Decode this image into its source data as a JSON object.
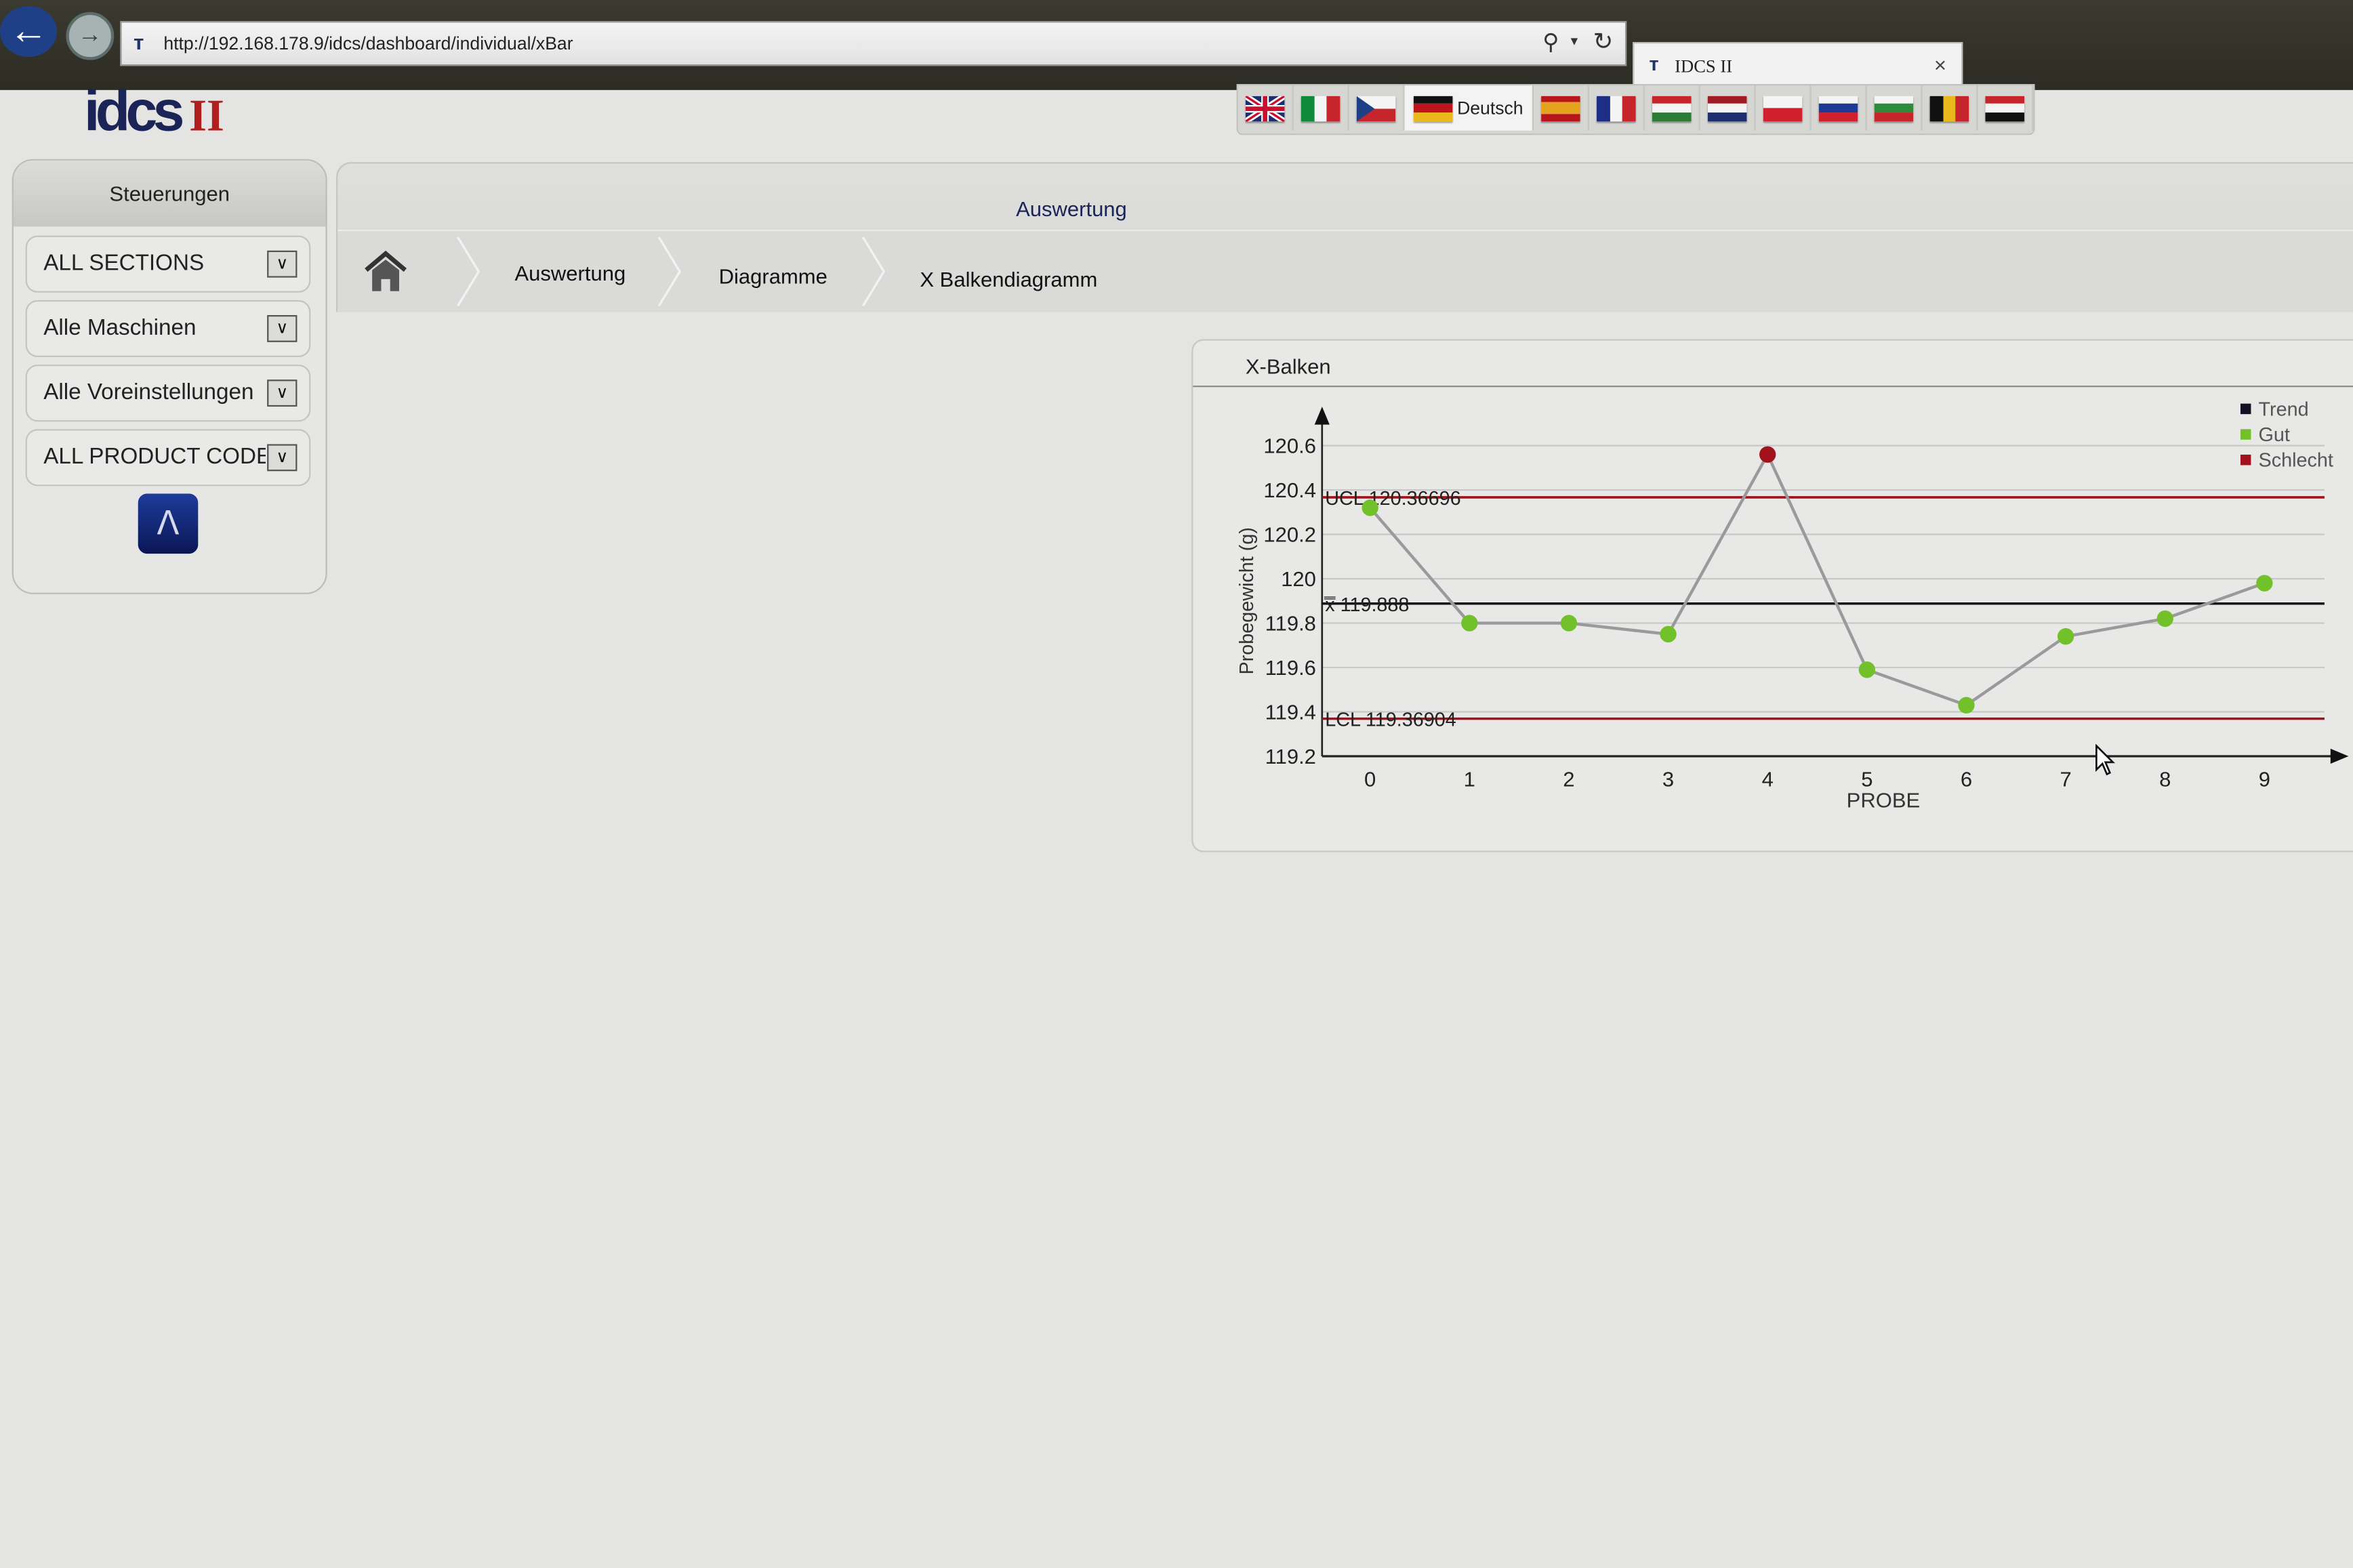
{
  "browser": {
    "url": "http://192.168.178.9/idcs/dashboard/individual/xBar",
    "tab_title": "IDCS II",
    "tab_close": "×",
    "back_icon": "arrow-left-icon",
    "forward_icon": "arrow-right-icon"
  },
  "header": {
    "logo_text": "idcs",
    "logo_roman": "II",
    "languages": [
      {
        "code": "en",
        "label": "",
        "colors": [
          "#1f2f6e",
          "#c8102e",
          "#ffffff"
        ],
        "dir": "uk"
      },
      {
        "code": "it",
        "label": "",
        "colors": [
          "#0f8a3a",
          "#f4f4f4",
          "#c6252c"
        ],
        "dir": "v"
      },
      {
        "code": "cz",
        "label": "",
        "colors": [
          "#f4f4f4",
          "#c6252c",
          "#1d3f86"
        ],
        "dir": "cz"
      },
      {
        "code": "de",
        "label": "Deutsch",
        "colors": [
          "#111111",
          "#c0141c",
          "#e9b81a"
        ],
        "dir": "h",
        "active": true
      },
      {
        "code": "es",
        "label": "",
        "colors": [
          "#b6151c",
          "#e5a21e",
          "#b6151c"
        ],
        "dir": "es"
      },
      {
        "code": "fr",
        "label": "",
        "colors": [
          "#1d2e85",
          "#f4f4f4",
          "#c6252c"
        ],
        "dir": "v"
      },
      {
        "code": "hu",
        "label": "",
        "colors": [
          "#c6252c",
          "#f4f4f4",
          "#2d7c35"
        ],
        "dir": "h"
      },
      {
        "code": "nl",
        "label": "",
        "colors": [
          "#a11b24",
          "#f4f4f4",
          "#1d2e6e"
        ],
        "dir": "h"
      },
      {
        "code": "pl",
        "label": "",
        "colors": [
          "#f4f4f4",
          "#d0202e"
        ],
        "dir": "h"
      },
      {
        "code": "ru",
        "label": "",
        "colors": [
          "#f4f4f4",
          "#1d3a95",
          "#d0202e"
        ],
        "dir": "h"
      },
      {
        "code": "bg",
        "label": "",
        "colors": [
          "#f4f4f4",
          "#2f8a3a",
          "#c6252c"
        ],
        "dir": "h"
      },
      {
        "code": "be",
        "label": "",
        "colors": [
          "#111111",
          "#e9b81a",
          "#c6252c"
        ],
        "dir": "v"
      },
      {
        "code": "eg",
        "label": "",
        "colors": [
          "#c6252c",
          "#f4f4f4",
          "#111111"
        ],
        "dir": "h"
      }
    ]
  },
  "sidebar": {
    "title": "Steuerungen",
    "selects": [
      {
        "value": "ALL SECTIONS"
      },
      {
        "value": "Alle Maschinen"
      },
      {
        "value": "Alle Voreinstellungen"
      },
      {
        "value": "ALL PRODUCT CODES"
      }
    ],
    "pdf_icon": "pdf-icon"
  },
  "main": {
    "title": "Auswertung",
    "breadcrumb": [
      "Auswertung",
      "Diagramme",
      "X Balkendiagramm"
    ]
  },
  "panel": {
    "title": "X-Balken"
  },
  "chart_data": {
    "type": "line",
    "title": "X-Balken",
    "xlabel": "PROBE",
    "ylabel": "Probegewicht (g)",
    "x": [
      0,
      1,
      2,
      3,
      4,
      5,
      6,
      7,
      8,
      9
    ],
    "x_ticks": [
      "0",
      "1",
      "2",
      "3",
      "4",
      "5",
      "6",
      "7",
      "8",
      "9"
    ],
    "y_ticks": [
      "119.2",
      "119.4",
      "119.6",
      "119.8",
      "120",
      "120.2",
      "120.4",
      "120.6"
    ],
    "ylim": [
      119.2,
      120.6
    ],
    "grid": true,
    "series": [
      {
        "name": "Probegewicht",
        "values": [
          120.32,
          119.8,
          119.8,
          119.75,
          120.56,
          119.59,
          119.43,
          119.74,
          119.82,
          119.98
        ],
        "status": [
          "Gut",
          "Gut",
          "Gut",
          "Gut",
          "Schlecht",
          "Gut",
          "Gut",
          "Gut",
          "Gut",
          "Gut"
        ]
      }
    ],
    "reference_lines": [
      {
        "name": "UCL",
        "label": "UCL 120.36696",
        "value": 120.36696,
        "color": "#a3111c"
      },
      {
        "name": "Mean",
        "label": "x̿ 119.888",
        "value": 119.888,
        "color": "#111111"
      },
      {
        "name": "LCL",
        "label": "LCL 119.36904",
        "value": 119.36904,
        "color": "#a3111c"
      }
    ],
    "legend": {
      "position": "top-right",
      "entries": [
        {
          "label": "Trend",
          "color": "#111122"
        },
        {
          "label": "Gut",
          "color": "#72c02a"
        },
        {
          "label": "Schlecht",
          "color": "#a3111c"
        }
      ]
    },
    "colors": {
      "line": "#9a9a9c",
      "good": "#72c02a",
      "bad": "#a3111c"
    }
  }
}
